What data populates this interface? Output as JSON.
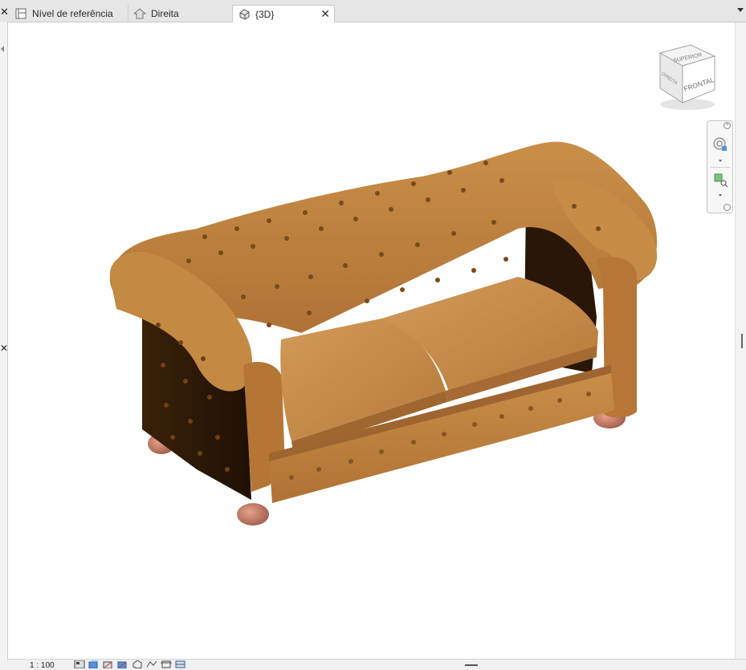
{
  "tabs": [
    {
      "label": "Nível de referência",
      "icon": "floor-plan-icon",
      "active": false
    },
    {
      "label": "Direita",
      "icon": "elevation-icon",
      "active": false
    },
    {
      "label": "{3D}",
      "icon": "3d-view-icon",
      "active": true
    }
  ],
  "viewcube": {
    "top_face": "SUPERIOR",
    "front_face": "FRONTAL",
    "left_face": "DIREITA"
  },
  "status": {
    "scale": "1 : 100"
  },
  "colors": {
    "accent": "#c4883f",
    "viewport_bg": "#ffffff",
    "active_tab_bg": "#ffffff"
  }
}
